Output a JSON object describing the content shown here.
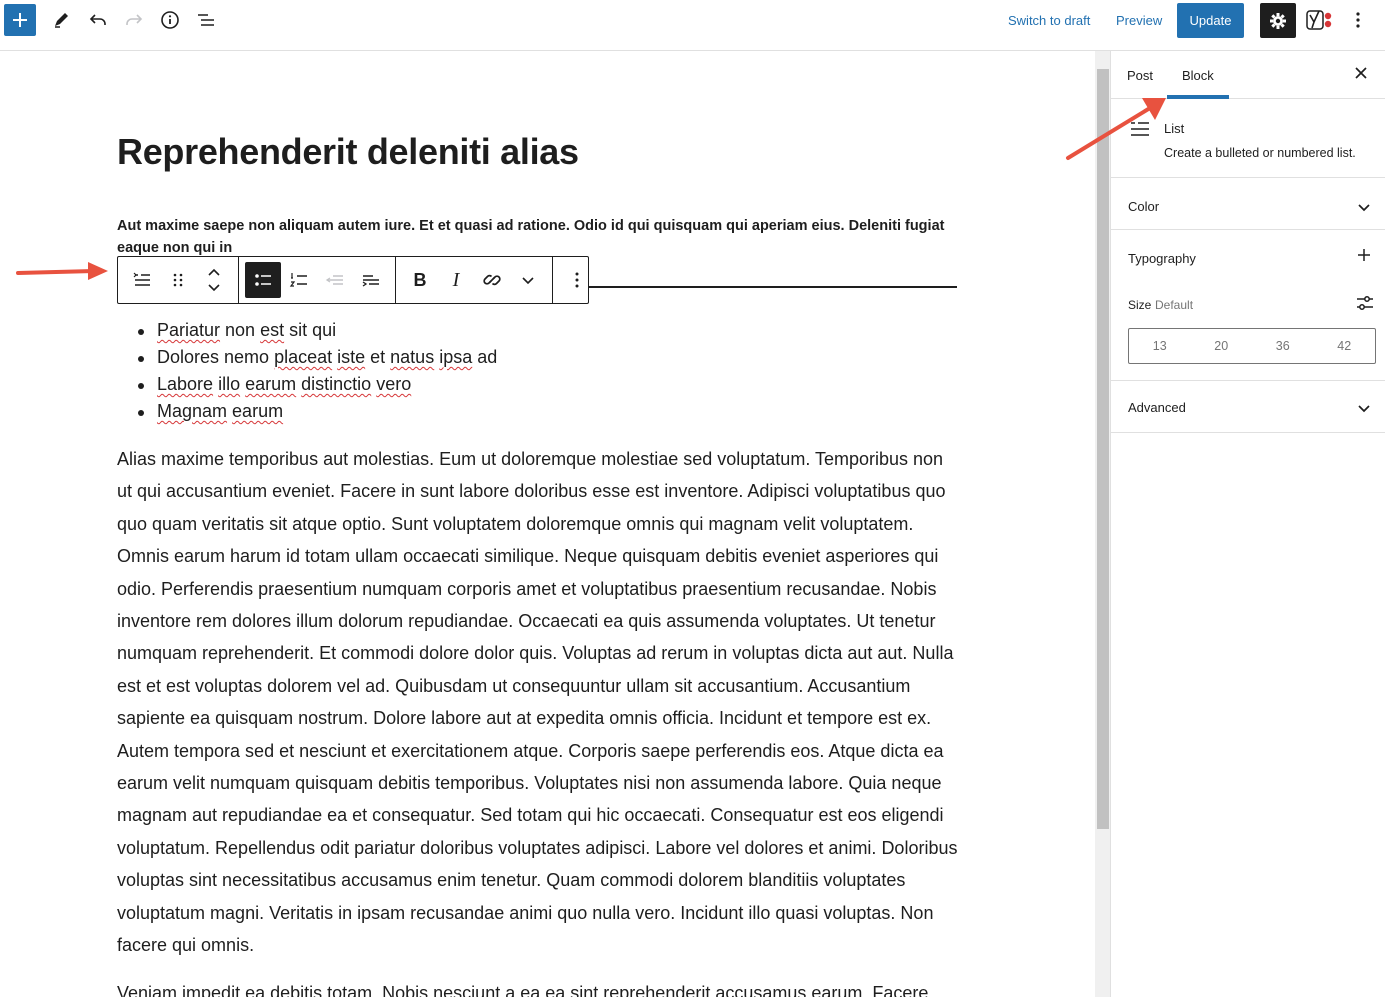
{
  "topbar": {
    "switch_to_draft": "Switch to draft",
    "preview": "Preview",
    "update": "Update",
    "accent_color": "#2271b1"
  },
  "post": {
    "title": "Reprehenderit deleniti alias",
    "intro": "Aut maxime saepe non aliquam autem iure. Et et quasi ad ratione. Odio id qui quisquam qui aperiam eius. Deleniti fugiat eaque non qui in",
    "list_items": [
      [
        {
          "t": "Pariatur",
          "sq": true
        },
        {
          "t": " non ",
          "sq": false
        },
        {
          "t": "est",
          "sq": true
        },
        {
          "t": " sit qui",
          "sq": false
        }
      ],
      [
        {
          "t": "Dolores nemo ",
          "sq": false
        },
        {
          "t": "placeat",
          "sq": true
        },
        {
          "t": " ",
          "sq": false
        },
        {
          "t": "iste",
          "sq": true
        },
        {
          "t": " et ",
          "sq": false
        },
        {
          "t": "natus",
          "sq": true
        },
        {
          "t": " ",
          "sq": false
        },
        {
          "t": "ipsa",
          "sq": true
        },
        {
          "t": " ad",
          "sq": false
        }
      ],
      [
        {
          "t": "Labore",
          "sq": true
        },
        {
          "t": " ",
          "sq": false
        },
        {
          "t": "illo",
          "sq": true
        },
        {
          "t": " ",
          "sq": false
        },
        {
          "t": "earum",
          "sq": true
        },
        {
          "t": " ",
          "sq": false
        },
        {
          "t": "distinctio",
          "sq": true
        },
        {
          "t": " ",
          "sq": false
        },
        {
          "t": "vero",
          "sq": true
        }
      ],
      [
        {
          "t": "Magnam",
          "sq": true
        },
        {
          "t": " ",
          "sq": false
        },
        {
          "t": "earum",
          "sq": true
        }
      ]
    ],
    "paragraph": "Alias maxime temporibus aut molestias. Eum ut doloremque molestiae sed voluptatum. Temporibus non ut qui accusantium eveniet. Facere in sunt labore doloribus esse est inventore. Adipisci voluptatibus quo quo quam veritatis sit atque optio. Sunt voluptatem doloremque omnis qui magnam velit voluptatem. Omnis earum harum id totam ullam occaecati similique. Neque quisquam debitis eveniet asperiores qui odio. Perferendis praesentium numquam corporis amet et voluptatibus praesentium recusandae. Nobis inventore rem dolores illum dolorum repudiandae. Occaecati ea quis assumenda voluptates. Ut tenetur numquam reprehenderit. Et commodi dolore dolor quis. Voluptas ad rerum in voluptas dicta aut aut. Nulla est et est voluptas dolorem vel ad. Quibusdam ut consequuntur ullam sit accusantium. Accusantium sapiente ea quisquam nostrum. Dolore labore aut at expedita omnis officia. Incidunt et tempore est ex. Autem tempora sed et nesciunt et exercitationem atque. Corporis saepe perferendis eos. Atque dicta ea earum velit numquam quisquam debitis temporibus. Voluptates nisi non assumenda labore. Quia neque magnam aut repudiandae ea et consequatur. Sed totam qui hic occaecati. Consequatur est eos eligendi voluptatum. Repellendus odit pariatur doloribus voluptates adipisci. Labore vel dolores et animi. Doloribus voluptas sint necessitatibus accusamus enim tenetur. Quam commodi dolorem blanditiis voluptates voluptatum magni. Veritatis in ipsam recusandae animi quo nulla vero. Incidunt illo quasi voluptas. Non facere qui omnis.",
    "paragraph2": "Veniam impedit ea debitis totam. Nobis nesciunt a ea ea sint reprehenderit accusamus earum. Facere"
  },
  "block_toolbar": {
    "bold": "B",
    "italic": "I"
  },
  "sidebar": {
    "tab_post": "Post",
    "tab_block": "Block",
    "block_name": "List",
    "block_description": "Create a bulleted or numbered list.",
    "color_panel": "Color",
    "typography_panel": "Typography",
    "size_label": "Size",
    "size_value": "Default",
    "size_options": [
      "13",
      "20",
      "36",
      "42"
    ],
    "advanced_panel": "Advanced"
  },
  "annotation_color": "#e8523f"
}
